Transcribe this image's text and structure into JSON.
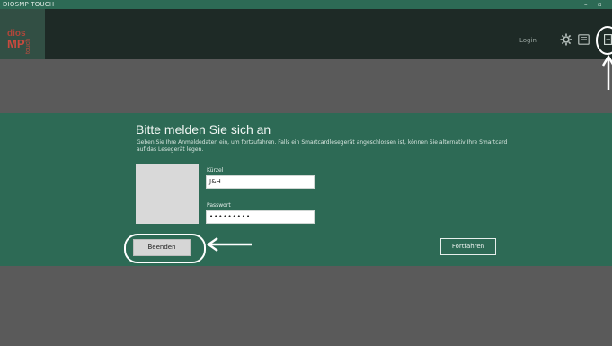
{
  "window": {
    "title": "DIOSMP TOUCH",
    "minimize_glyph": "–",
    "maximize_glyph": "▫"
  },
  "logo": {
    "line1": "dios",
    "line2": "MP",
    "vertical": "touch"
  },
  "header": {
    "login_label": "Login"
  },
  "login": {
    "heading": "Bitte melden Sie sich an",
    "description": "Geben Sie Ihre Anmeldedaten ein, um fortzufahren. Falls ein Smartcardlesegerät angeschlossen ist, können Sie alternativ Ihre Smartcard auf das Lesegerät legen.",
    "username_label": "Kürzel",
    "username_value": "J&H",
    "password_label": "Passwort",
    "password_value": "•••••••••",
    "quit_label": "Beenden",
    "continue_label": "Fortfahren"
  },
  "colors": {
    "green": "#2d6a55",
    "topbar": "#1e2a26",
    "background": "#5a5a5a"
  },
  "icons": [
    "gear-icon",
    "keyboard-icon",
    "logout-icon"
  ]
}
